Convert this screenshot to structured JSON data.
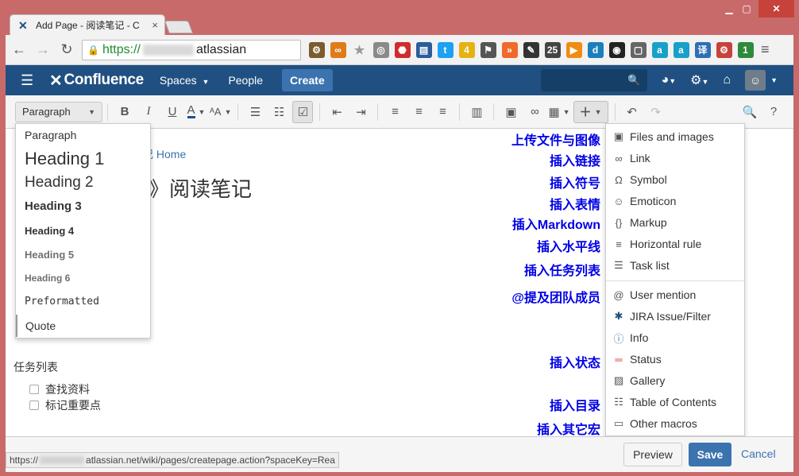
{
  "browser": {
    "tab_title": "Add Page - 阅读笔记 - C",
    "tab_close": "×",
    "url_scheme": "https://",
    "url_host_fragment": "atlassian",
    "status_url_prefix": "https://",
    "status_url_suffix": "atlassian.net/wiki/pages/createpage.action?spaceKey=Rea",
    "extension_badges": {
      "ext3": "4",
      "ext10": "25",
      "ext22": "1"
    }
  },
  "header": {
    "logo": "Confluence",
    "spaces": "Spaces",
    "people": "People",
    "create": "Create"
  },
  "editor_toolbar": {
    "paragraph": "Paragraph",
    "bold": "B",
    "italic": "I",
    "underline": "U",
    "color": "A"
  },
  "content": {
    "breadcrumb": "记 Home",
    "title_fragment": "》阅读笔记",
    "task_heading": "任务列表",
    "tasks": [
      "查找资料",
      "标记重要点"
    ]
  },
  "paragraph_menu": [
    "Paragraph",
    "Heading 1",
    "Heading 2",
    "Heading 3",
    "Heading 4",
    "Heading 5",
    "Heading 6",
    "Preformatted",
    "Quote"
  ],
  "insert_menu": [
    {
      "label": "Files and images",
      "icon": "image-icon"
    },
    {
      "label": "Link",
      "icon": "link-icon"
    },
    {
      "label": "Symbol",
      "icon": "omega-icon"
    },
    {
      "label": "Emoticon",
      "icon": "smiley-icon"
    },
    {
      "label": "Markup",
      "icon": "markup-icon"
    },
    {
      "label": "Horizontal rule",
      "icon": "horizontal-rule-icon"
    },
    {
      "label": "Task list",
      "icon": "task-list-icon"
    },
    {
      "label": "User mention",
      "icon": "at-icon"
    },
    {
      "label": "JIRA Issue/Filter",
      "icon": "jira-icon"
    },
    {
      "label": "Info",
      "icon": "info-icon"
    },
    {
      "label": "Status",
      "icon": "status-icon"
    },
    {
      "label": "Gallery",
      "icon": "gallery-icon"
    },
    {
      "label": "Table of Contents",
      "icon": "toc-icon"
    },
    {
      "label": "Other macros",
      "icon": "macro-icon"
    }
  ],
  "annotations": [
    "上传文件与图像",
    "插入链接",
    "插入符号",
    "插入表情",
    "插入Markdown",
    "插入水平线",
    "插入任务列表",
    "@提及团队成员",
    "插入状态",
    "插入目录",
    "插入其它宏"
  ],
  "footer": {
    "preview": "Preview",
    "save": "Save",
    "cancel": "Cancel"
  }
}
